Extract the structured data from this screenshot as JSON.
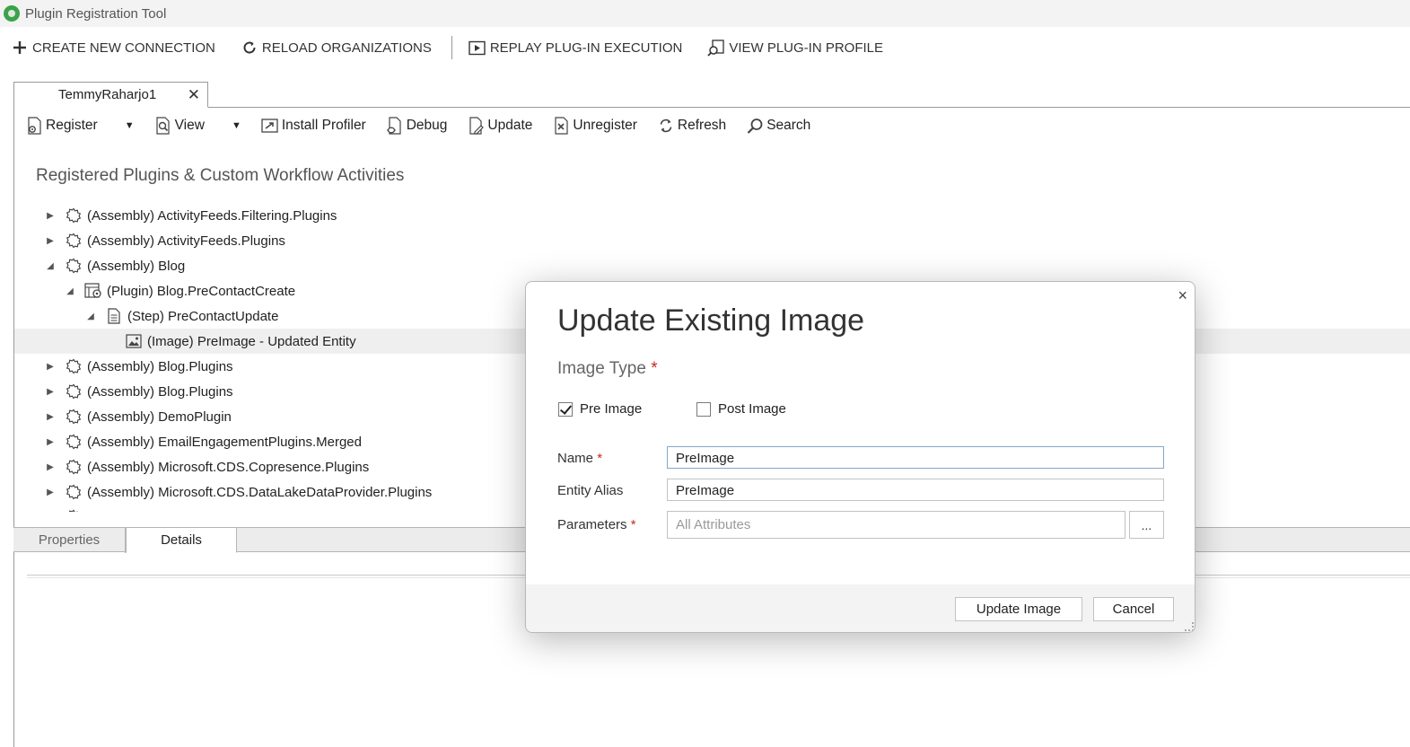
{
  "app": {
    "title": "Plugin Registration Tool"
  },
  "commandbar": {
    "create_new_connection": "CREATE NEW CONNECTION",
    "reload_organizations": "RELOAD ORGANIZATIONS",
    "replay_plugin_execution": "REPLAY PLUG-IN EXECUTION",
    "view_plugin_profile": "VIEW PLUG-IN PROFILE"
  },
  "connection_tab": {
    "label": "TemmyRaharjo1"
  },
  "toolbar": {
    "register": "Register",
    "view": "View",
    "install_profiler": "Install Profiler",
    "debug": "Debug",
    "update": "Update",
    "unregister": "Unregister",
    "refresh": "Refresh",
    "search": "Search"
  },
  "section": {
    "title": "Registered Plugins & Custom Workflow Activities"
  },
  "tree": [
    {
      "label": "(Assembly) ActivityFeeds.Filtering.Plugins",
      "level": 0,
      "expanded": false,
      "kind": "assembly"
    },
    {
      "label": "(Assembly) ActivityFeeds.Plugins",
      "level": 0,
      "expanded": false,
      "kind": "assembly"
    },
    {
      "label": "(Assembly) Blog",
      "level": 0,
      "expanded": true,
      "kind": "assembly"
    },
    {
      "label": "(Plugin) Blog.PreContactCreate",
      "level": 1,
      "expanded": true,
      "kind": "plugin"
    },
    {
      "label": "(Step) PreContactUpdate",
      "level": 2,
      "expanded": true,
      "kind": "step"
    },
    {
      "label": "(Image) PreImage - Updated Entity",
      "level": 3,
      "expanded": null,
      "kind": "image",
      "selected": true
    },
    {
      "label": "(Assembly) Blog.Plugins",
      "level": 0,
      "expanded": false,
      "kind": "assembly"
    },
    {
      "label": "(Assembly) Blog.Plugins",
      "level": 0,
      "expanded": false,
      "kind": "assembly"
    },
    {
      "label": "(Assembly) DemoPlugin",
      "level": 0,
      "expanded": false,
      "kind": "assembly"
    },
    {
      "label": "(Assembly) EmailEngagementPlugins.Merged",
      "level": 0,
      "expanded": false,
      "kind": "assembly"
    },
    {
      "label": "(Assembly) Microsoft.CDS.Copresence.Plugins",
      "level": 0,
      "expanded": false,
      "kind": "assembly"
    },
    {
      "label": "(Assembly) Microsoft.CDS.DataLakeDataProvider.Plugins",
      "level": 0,
      "expanded": false,
      "kind": "assembly"
    },
    {
      "label": "(Assembly) Microsoft.CDS.InsightsAppPlatform.Plugins",
      "level": 0,
      "expanded": false,
      "kind": "assembly"
    }
  ],
  "bottom_tabs": {
    "properties": "Properties",
    "details": "Details"
  },
  "modal": {
    "title": "Update Existing Image",
    "image_type_label": "Image Type",
    "required_marker": "*",
    "pre_image_label": "Pre Image",
    "pre_image_checked": true,
    "post_image_label": "Post Image",
    "post_image_checked": false,
    "name_label": "Name",
    "name_value": "PreImage",
    "entity_alias_label": "Entity Alias",
    "entity_alias_value": "PreImage",
    "parameters_label": "Parameters",
    "parameters_value": "All Attributes",
    "ellipsis": "...",
    "update_button": "Update Image",
    "cancel_button": "Cancel",
    "close_glyph": "×"
  },
  "colors": {
    "accent_green": "#3aa34a",
    "required_red": "#c42b1c",
    "selection_gray": "#efefef"
  }
}
